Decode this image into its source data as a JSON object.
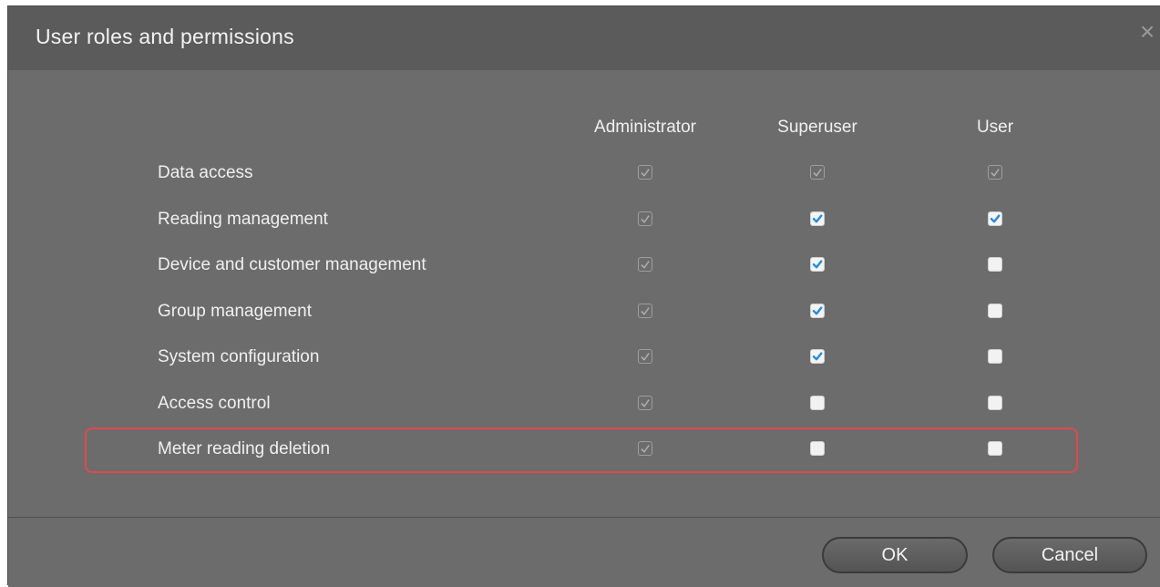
{
  "dialog": {
    "title": "User roles and permissions",
    "close_icon": "close-icon"
  },
  "columns": [
    "Administrator",
    "Superuser",
    "User"
  ],
  "rows": [
    {
      "label": "Data access",
      "administrator": "disabled-checked",
      "superuser": "disabled-checked",
      "user": "disabled-checked"
    },
    {
      "label": "Reading management",
      "administrator": "disabled-checked",
      "superuser": "checked",
      "user": "checked"
    },
    {
      "label": "Device and customer management",
      "administrator": "disabled-checked",
      "superuser": "checked",
      "user": "unchecked"
    },
    {
      "label": "Group management",
      "administrator": "disabled-checked",
      "superuser": "checked",
      "user": "unchecked"
    },
    {
      "label": "System configuration",
      "administrator": "disabled-checked",
      "superuser": "checked",
      "user": "unchecked"
    },
    {
      "label": "Access control",
      "administrator": "disabled-checked",
      "superuser": "unchecked",
      "user": "unchecked"
    },
    {
      "label": "Meter reading deletion",
      "administrator": "disabled-checked",
      "superuser": "unchecked",
      "user": "unchecked",
      "highlighted": true
    }
  ],
  "buttons": {
    "ok": "OK",
    "cancel": "Cancel"
  },
  "colors": {
    "check_accent": "#1e8ce6",
    "highlight_border": "#e04a4a",
    "dialog_background": "#6c6c6c"
  }
}
